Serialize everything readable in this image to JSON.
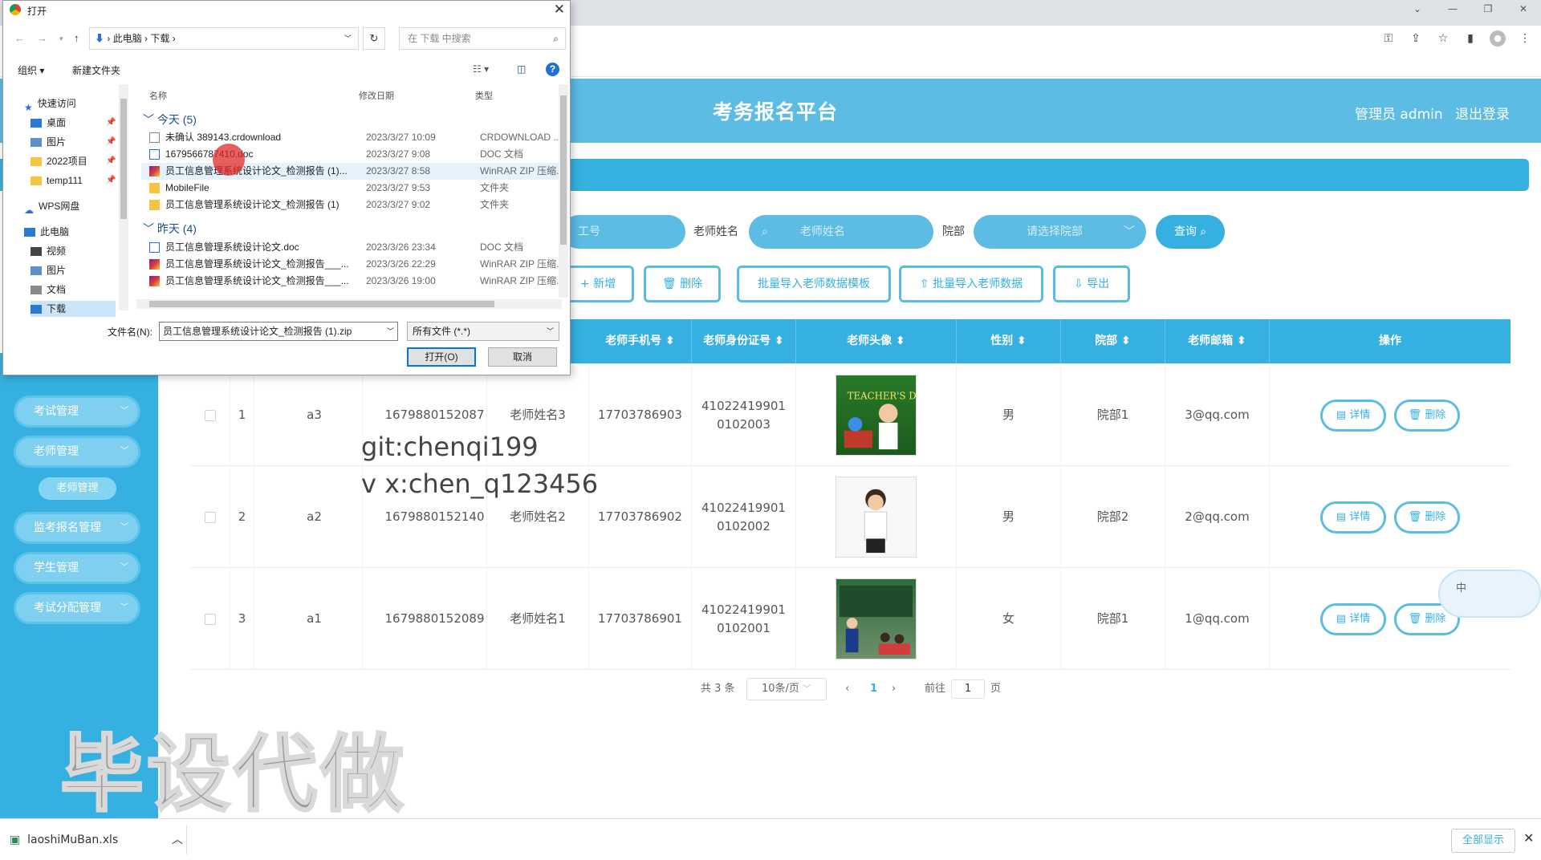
{
  "chrome": {
    "window_controls": [
      "⌄",
      "—",
      "❐",
      "✕"
    ],
    "toolbar_icons": [
      "key-icon",
      "share-icon",
      "star-icon",
      "sidebar-icon",
      "profile-icon",
      "menu-icon"
    ]
  },
  "header": {
    "title": "考务报名平台",
    "admin": "管理员 admin",
    "logout": "退出登录"
  },
  "search": {
    "id_placeholder": "工号",
    "name_label": "老师姓名",
    "name_placeholder": "老师姓名",
    "dept_label": "院部",
    "dept_placeholder": "请选择院部",
    "query": "查询"
  },
  "actions": {
    "add": "新增",
    "delete": "删除",
    "template": "批量导入老师数据模板",
    "import": "批量导入老师数据",
    "export": "导出"
  },
  "sidebar": {
    "items": [
      {
        "label": "考试管理"
      },
      {
        "label": "老师管理"
      },
      {
        "label": "监考报名管理"
      },
      {
        "label": "学生管理"
      },
      {
        "label": "考试分配管理"
      }
    ],
    "active_sub": "老师管理"
  },
  "table": {
    "columns": [
      "老师手机号",
      "老师身份证号",
      "老师头像",
      "性别",
      "院部",
      "老师邮箱",
      "操作"
    ],
    "rows": [
      {
        "index": "1",
        "id": "a3",
        "phone_id": "1679880152087",
        "name": "老师姓名3",
        "mobile": "17703786903",
        "idcard": "410224199010102003",
        "avatar": "TEACHER'S DAY",
        "gender": "男",
        "dept": "院部1",
        "email": "3@qq.com"
      },
      {
        "index": "2",
        "id": "a2",
        "phone_id": "1679880152140",
        "name": "老师姓名2",
        "mobile": "17703786902",
        "idcard": "410224199010102002",
        "avatar": "",
        "gender": "男",
        "dept": "院部2",
        "email": "2@qq.com"
      },
      {
        "index": "3",
        "id": "a1",
        "phone_id": "1679880152089",
        "name": "老师姓名1",
        "mobile": "17703786901",
        "idcard": "410224199010102001",
        "avatar": "",
        "gender": "女",
        "dept": "院部1",
        "email": "1@qq.com"
      }
    ],
    "detail": "详情",
    "remove": "删除"
  },
  "pagination": {
    "total": "共 3 条",
    "per_page": "10条/页",
    "current": "1",
    "goto": "前往",
    "page_input": "1",
    "page_unit": "页"
  },
  "overlays": {
    "git": "git:chenqi199",
    "vx": "v x:chen_q123456",
    "big": "毕设代做",
    "ime": "中"
  },
  "downloads": {
    "file": "laoshiMuBan.xls",
    "show_all": "全部显示"
  },
  "dialog": {
    "title": "打开",
    "breadcrumb": [
      "此电脑",
      "下载"
    ],
    "search_placeholder": "在 下载 中搜索",
    "organize": "组织 ▾",
    "new_folder": "新建文件夹",
    "nav": [
      "快速访问",
      "桌面",
      "图片",
      "2022项目",
      "temp111",
      "WPS网盘",
      "此电脑",
      "视频",
      "图片",
      "文档",
      "下载"
    ],
    "columns": {
      "name": "名称",
      "date": "修改日期",
      "type": "类型"
    },
    "groups": {
      "today": "今天 (5)",
      "yesterday": "昨天 (4)"
    },
    "today_files": [
      {
        "name": "未确认 389143.crdownload",
        "date": "2023/3/27 10:09",
        "type": "CRDOWNLOAD ..."
      },
      {
        "name": "1679566787410.doc",
        "date": "2023/3/27 9:08",
        "type": "DOC 文档"
      },
      {
        "name": "员工信息管理系统设计论文_检测报告 (1)...",
        "date": "2023/3/27 8:58",
        "type": "WinRAR ZIP 压缩..."
      },
      {
        "name": "MobileFile",
        "date": "2023/3/27 9:53",
        "type": "文件夹"
      },
      {
        "name": "员工信息管理系统设计论文_检测报告 (1)",
        "date": "2023/3/27 9:02",
        "type": "文件夹"
      }
    ],
    "yesterday_files": [
      {
        "name": "员工信息管理系统设计论文.doc",
        "date": "2023/3/26 23:34",
        "type": "DOC 文档"
      },
      {
        "name": "员工信息管理系统设计论文_检测报告___...",
        "date": "2023/3/26 22:29",
        "type": "WinRAR ZIP 压缩..."
      },
      {
        "name": "员工信息管理系统设计论文_检测报告___...",
        "date": "2023/3/26 19:00",
        "type": "WinRAR ZIP 压缩..."
      }
    ],
    "filename_label": "文件名(N):",
    "filename_value": "员工信息管理系统设计论文_检测报告 (1).zip",
    "filetype": "所有文件 (*.*)",
    "open": "打开(O)",
    "cancel": "取消"
  }
}
